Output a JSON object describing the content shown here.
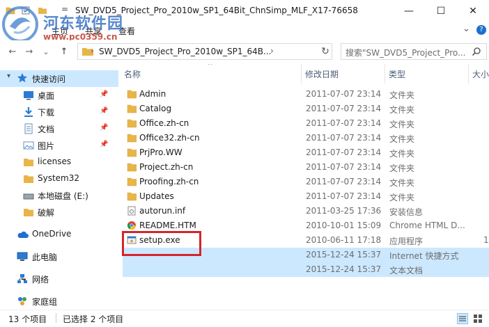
{
  "window": {
    "title": "SW_DVD5_Project_Pro_2010w_SP1_64Bit_ChnSimp_MLF_X17-76658",
    "qat_separator": "=",
    "minimize": "—",
    "maximize": "☐",
    "close": "✕"
  },
  "watermark": {
    "text": "河东软件园",
    "url": "www.pc0359.cn"
  },
  "ribbon": {
    "tabs": [
      "主页",
      "共享",
      "查看"
    ],
    "expand": "⌄",
    "help": "?"
  },
  "address": {
    "back": "←",
    "forward": "→",
    "recent": "⌄",
    "up": "↑",
    "path": "SW_DVD5_Project_Pro_2010w_SP1_64B...",
    "chevron": "›",
    "refresh": "↻",
    "search_placeholder": "搜索\"SW_DVD5_Project_Pro..."
  },
  "nav": {
    "quick_access": "快速访问",
    "items": [
      {
        "label": "桌面",
        "pinned": "📌"
      },
      {
        "label": "下载",
        "pinned": "📌"
      },
      {
        "label": "文档",
        "pinned": "📌"
      },
      {
        "label": "图片",
        "pinned": "📌"
      },
      {
        "label": "licenses"
      },
      {
        "label": "System32"
      },
      {
        "label": "本地磁盘 (E:)"
      },
      {
        "label": "破解"
      }
    ],
    "onedrive": "OneDrive",
    "thispc": "此电脑",
    "network": "网络",
    "homegroup": "家庭组"
  },
  "columns": {
    "name": "名称",
    "date": "修改日期",
    "type": "类型",
    "size": "大小"
  },
  "files": [
    {
      "name": "Admin",
      "date": "2011-07-07 23:14",
      "type": "文件夹",
      "size": "",
      "icon": "folder"
    },
    {
      "name": "Catalog",
      "date": "2011-07-07 23:14",
      "type": "文件夹",
      "size": "",
      "icon": "folder"
    },
    {
      "name": "Office.zh-cn",
      "date": "2011-07-07 23:14",
      "type": "文件夹",
      "size": "",
      "icon": "folder"
    },
    {
      "name": "Office32.zh-cn",
      "date": "2011-07-07 23:14",
      "type": "文件夹",
      "size": "",
      "icon": "folder"
    },
    {
      "name": "PrjPro.WW",
      "date": "2011-07-07 23:14",
      "type": "文件夹",
      "size": "",
      "icon": "folder"
    },
    {
      "name": "Project.zh-cn",
      "date": "2011-07-07 23:14",
      "type": "文件夹",
      "size": "",
      "icon": "folder"
    },
    {
      "name": "Proofing.zh-cn",
      "date": "2011-07-07 23:14",
      "type": "文件夹",
      "size": "",
      "icon": "folder"
    },
    {
      "name": "Updates",
      "date": "2011-07-07 23:14",
      "type": "文件夹",
      "size": "",
      "icon": "folder"
    },
    {
      "name": "autorun.inf",
      "date": "2011-03-25 17:36",
      "type": "安装信息",
      "size": "",
      "icon": "inf"
    },
    {
      "name": "README.HTM",
      "date": "2010-10-01 15:09",
      "type": "Chrome HTML D...",
      "size": "",
      "icon": "chrome"
    },
    {
      "name": "setup.exe",
      "date": "2010-06-11 17:18",
      "type": "应用程序",
      "size": "1",
      "icon": "exe"
    },
    {
      "name": "",
      "date": "2015-12-24 15:37",
      "type": "Internet 快捷方式",
      "size": "",
      "icon": "none",
      "selected": true
    },
    {
      "name": "",
      "date": "2015-12-24 15:37",
      "type": "文本文档",
      "size": "",
      "icon": "none",
      "selected": true
    }
  ],
  "status": {
    "count": "13 个项目",
    "selected": "已选择 2 个项目"
  },
  "colors": {
    "selection": "#cce8ff",
    "folder": "#e8b548",
    "highlight": "#d6242b",
    "accent": "#0078d7"
  }
}
